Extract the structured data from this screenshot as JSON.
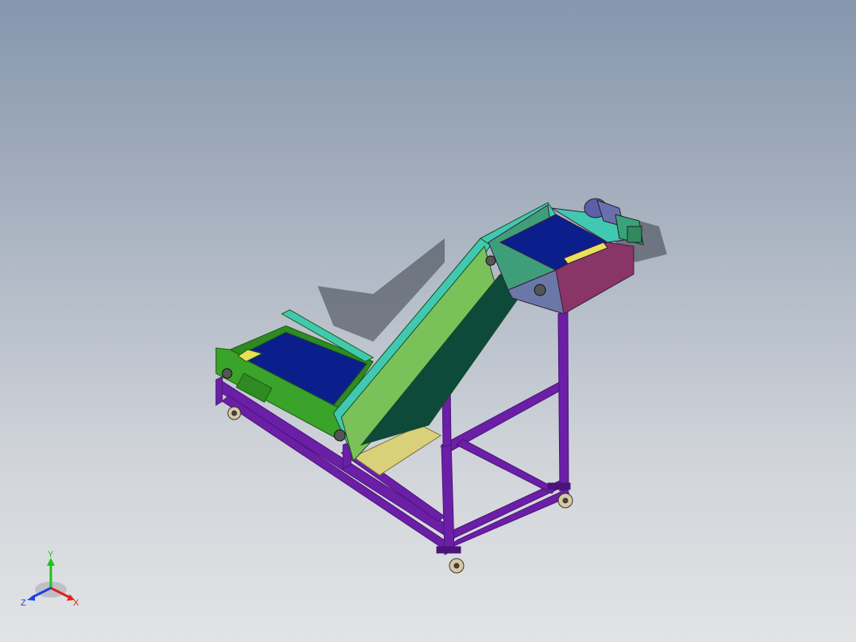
{
  "viewport": {
    "background_top": "#8696ad",
    "background_bottom": "#e2e3e5"
  },
  "model": {
    "frame_color": "#6b1fa6",
    "belt_color": "#0b1f8c",
    "trough_color": "#3aa32a",
    "incline_color": "#7ac15a",
    "rail_color": "#40c9b0",
    "hopper_color": "#8a3568",
    "motor_color": "#5a5fa8",
    "tray_color": "#d9d07a"
  },
  "triad": {
    "x_label": "X",
    "y_label": "Y",
    "z_label": "Z",
    "x_color": "#e02020",
    "y_color": "#20c020",
    "z_color": "#2040e0"
  }
}
